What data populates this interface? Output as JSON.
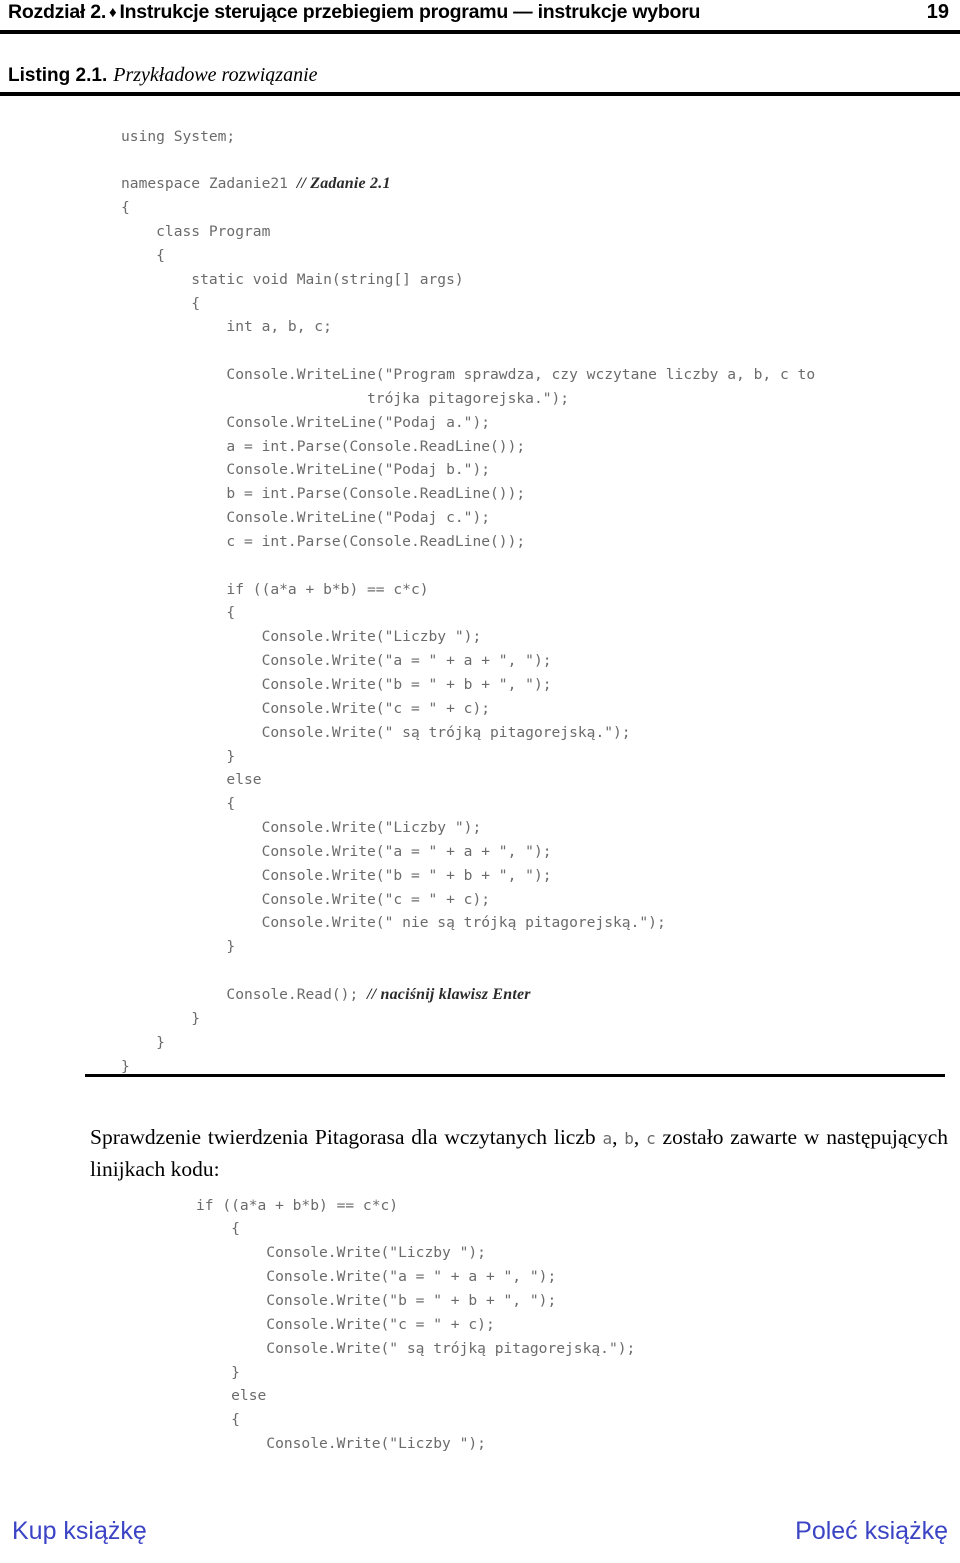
{
  "header": {
    "chapter": "Rozdział 2.",
    "diamond": "♦",
    "title": "Instrukcje sterujące przebiegiem programu — instrukcje wyboru",
    "page_number": "19"
  },
  "listing": {
    "label": "Listing 2.1.",
    "title": "Przykładowe rozwiązanie"
  },
  "code_main": {
    "lines": [
      "using System;",
      "",
      "namespace Zadanie21 ",
      "{",
      "    class Program",
      "    {",
      "        static void Main(string[] args)",
      "        {",
      "            int a, b, c;",
      "",
      "            Console.WriteLine(\"Program sprawdza, czy wczytane liczby a, b, c to",
      "                            trójka pitagorejska.\");",
      "            Console.WriteLine(\"Podaj a.\");",
      "            a = int.Parse(Console.ReadLine());",
      "            Console.WriteLine(\"Podaj b.\");",
      "            b = int.Parse(Console.ReadLine());",
      "            Console.WriteLine(\"Podaj c.\");",
      "            c = int.Parse(Console.ReadLine());",
      "",
      "            if ((a*a + b*b) == c*c)",
      "            {",
      "                Console.Write(\"Liczby \");",
      "                Console.Write(\"a = \" + a + \", \");",
      "                Console.Write(\"b = \" + b + \", \");",
      "                Console.Write(\"c = \" + c);",
      "                Console.Write(\" są trójką pitagorejską.\");",
      "            }",
      "            else",
      "            {",
      "                Console.Write(\"Liczby \");",
      "                Console.Write(\"a = \" + a + \", \");",
      "                Console.Write(\"b = \" + b + \", \");",
      "                Console.Write(\"c = \" + c);",
      "                Console.Write(\" nie są trójką pitagorejską.\");",
      "            }",
      "",
      "            Console.Read(); ",
      "        }",
      "    }",
      "}"
    ],
    "comment_namespace": "// Zadanie 2.1",
    "comment_read": "// naciśnij klawisz Enter"
  },
  "paragraph": {
    "part1": "Sprawdzenie twierdzenia Pitagorasa dla wczytanych liczb ",
    "code_a": "a",
    "sep1": ", ",
    "code_b": "b",
    "sep2": ", ",
    "code_c": "c",
    "part2": " zostało zawarte w następujących linijkach kodu:"
  },
  "code_tail": {
    "lines": [
      "if ((a*a + b*b) == c*c)",
      "    {",
      "        Console.Write(\"Liczby \");",
      "        Console.Write(\"a = \" + a + \", \");",
      "        Console.Write(\"b = \" + b + \", \");",
      "        Console.Write(\"c = \" + c);",
      "        Console.Write(\" są trójką pitagorejską.\");",
      "    }",
      "    else",
      "    {",
      "        Console.Write(\"Liczby \");"
    ]
  },
  "footer": {
    "buy_label": "Kup książkę",
    "recommend_label": "Poleć książkę",
    "link_color": "#3b44c4"
  }
}
